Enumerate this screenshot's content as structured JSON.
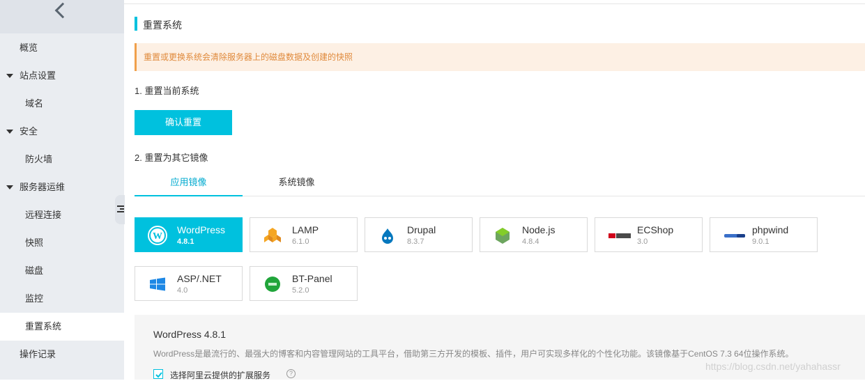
{
  "sidebar": {
    "items": [
      {
        "label": "概览"
      },
      {
        "label": "站点设置"
      },
      {
        "label": "域名"
      },
      {
        "label": "安全"
      },
      {
        "label": "防火墙"
      },
      {
        "label": "服务器运维"
      },
      {
        "label": "远程连接"
      },
      {
        "label": "快照"
      },
      {
        "label": "磁盘"
      },
      {
        "label": "监控"
      },
      {
        "label": "重置系统"
      },
      {
        "label": "操作记录"
      }
    ],
    "active": "重置系统"
  },
  "main": {
    "title": "重置系统",
    "warning": "重置或更换系统会清除服务器上的磁盘数据及创建的快照",
    "step1": "1. 重置当前系统",
    "confirm_button": "确认重置",
    "step2": "2. 重置为其它镜像",
    "tabs": [
      {
        "label": "应用镜像",
        "active": true
      },
      {
        "label": "系统镜像",
        "active": false
      }
    ],
    "images": [
      {
        "name": "WordPress",
        "version": "4.8.1",
        "selected": true,
        "icon": "wordpress-icon"
      },
      {
        "name": "LAMP",
        "version": "6.1.0",
        "icon": "lamp-icon"
      },
      {
        "name": "Drupal",
        "version": "8.3.7",
        "icon": "drupal-icon"
      },
      {
        "name": "Node.js",
        "version": "4.8.4",
        "icon": "nodejs-icon"
      },
      {
        "name": "ECShop",
        "version": "3.0",
        "icon": "ecshop-icon"
      },
      {
        "name": "phpwind",
        "version": "9.0.1",
        "icon": "phpwind-icon"
      },
      {
        "name": "ASP/.NET",
        "version": "4.0",
        "icon": "windows-icon"
      },
      {
        "name": "BT-Panel",
        "version": "5.2.0",
        "icon": "btpanel-icon"
      }
    ],
    "detail": {
      "title": "WordPress 4.8.1",
      "description": "WordPress是最流行的、最强大的博客和内容管理网站的工具平台，借助第三方开发的模板、插件，用户可实现多样化的个性化功能。该镜像基于CentOS 7.3 64位操作系统。",
      "checkbox_label": "选择阿里云提供的扩展服务",
      "checked": true
    },
    "watermark": "https://blog.csdn.net/yahahassr"
  },
  "colors": {
    "accent": "#00c1de",
    "warning_bg": "#fdf0e4",
    "warning_text": "#e08a3c",
    "sidebar_bg": "#eaedf1"
  }
}
